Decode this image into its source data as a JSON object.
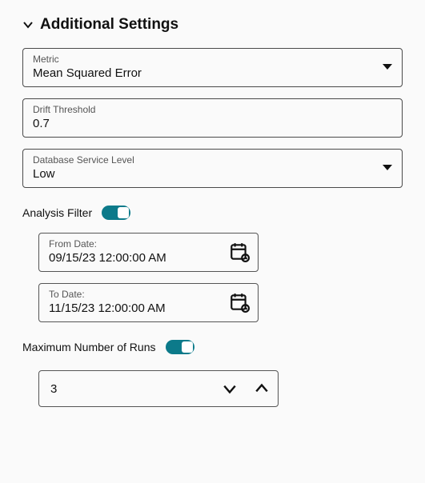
{
  "section": {
    "title": "Additional Settings"
  },
  "metric": {
    "label": "Metric",
    "value": "Mean Squared Error"
  },
  "drift": {
    "label": "Drift Threshold",
    "value": "0.7"
  },
  "dbservice": {
    "label": "Database Service Level",
    "value": "Low"
  },
  "analysis_filter": {
    "label": "Analysis Filter",
    "enabled": true
  },
  "from_date": {
    "label": "From Date:",
    "value": "09/15/23 12:00:00 AM"
  },
  "to_date": {
    "label": "To Date:",
    "value": "11/15/23 12:00:00 AM"
  },
  "max_runs": {
    "label": "Maximum Number of Runs",
    "enabled": true,
    "value": "3"
  }
}
